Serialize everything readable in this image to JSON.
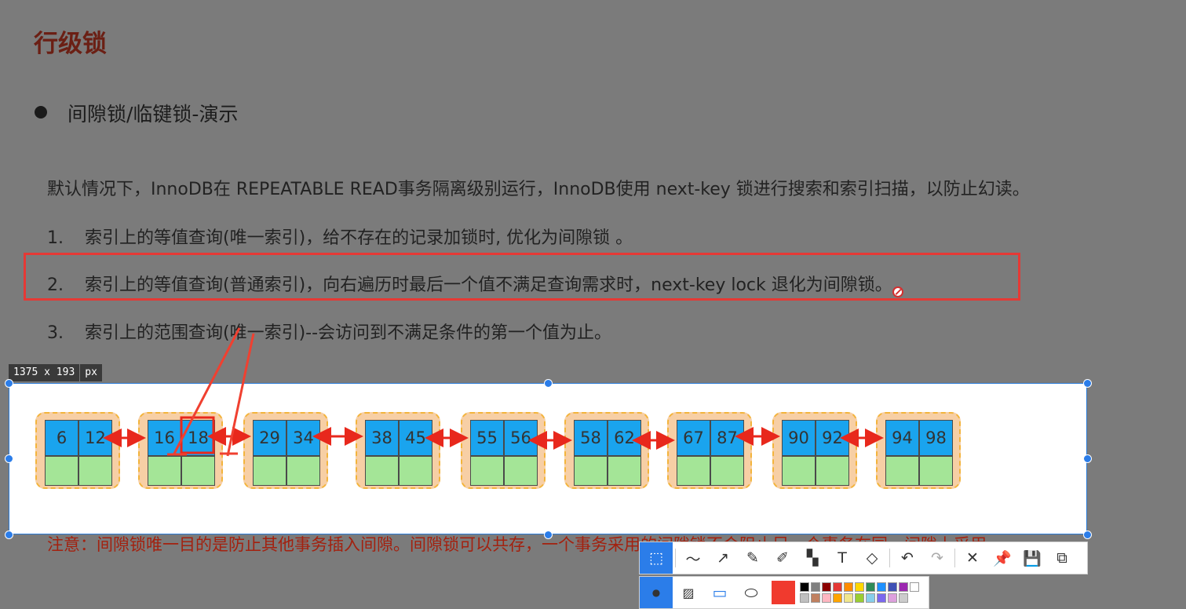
{
  "slide": {
    "title": "行级锁",
    "bullet": "间隙锁/临键锁-演示",
    "intro": "默认情况下，InnoDB在 REPEATABLE READ事务隔离级别运行，InnoDB使用 next-key 锁进行搜索和索引扫描，以防止幻读。",
    "items": [
      {
        "num": "1.",
        "text": "索引上的等值查询(唯一索引)，给不存在的记录加锁时, 优化为间隙锁 。"
      },
      {
        "num": "2.",
        "text": "索引上的等值查询(普通索引)，向右遍历时最后一个值不满足查询需求时，next-key lock 退化为间隙锁。"
      },
      {
        "num": "3.",
        "text": "索引上的范围查询(唯一索引)--会访问到不满足条件的第一个值为止。"
      }
    ],
    "note": "注意：间隙锁唯一目的是防止其他事务插入间隙。间隙锁可以共存，一个事务采用的间隙锁不会阻止另一个事务在同一间隙上采用"
  },
  "capture": {
    "size_label": "1375 x 193",
    "unit_label": "px",
    "nodes": [
      {
        "keys": [
          "6",
          "12"
        ]
      },
      {
        "keys": [
          "16",
          "18"
        ]
      },
      {
        "keys": [
          "29",
          "34"
        ]
      },
      {
        "keys": [
          "38",
          "45"
        ]
      },
      {
        "keys": [
          "55",
          "56"
        ]
      },
      {
        "keys": [
          "58",
          "62"
        ]
      },
      {
        "keys": [
          "67",
          "87"
        ]
      },
      {
        "keys": [
          "90",
          "92"
        ]
      },
      {
        "keys": [
          "94",
          "98"
        ]
      }
    ]
  },
  "colors": {
    "annotation_red": "#e53935",
    "key_cell": "#1aa4ee",
    "value_cell": "#a4e597",
    "node_bg": "#f7cfa5",
    "selection_blue": "#2b7de9"
  },
  "toolbar": {
    "tools": [
      "shape-tool-icon",
      "polyline-icon",
      "arrow-icon",
      "pencil-icon",
      "marker-icon",
      "mosaic-icon",
      "text-icon",
      "eraser-icon",
      "undo-icon",
      "redo-icon",
      "close-icon",
      "pin-icon",
      "save-icon",
      "copy-icon"
    ],
    "palette": [
      "#000000",
      "#808080",
      "#8b0000",
      "#e53935",
      "#ff8c00",
      "#ffd700",
      "#2e8b57",
      "#1e90ff",
      "#3f51b5",
      "#9c27b0",
      "#ffffff",
      "#c0c0c0",
      "#c08060",
      "#ffb6c1",
      "#ffa500",
      "#f0e68c",
      "#9acd32",
      "#87ceeb",
      "#7b68ee",
      "#dda0dd",
      "#cccccc"
    ],
    "current_color": "#f03a2e"
  }
}
